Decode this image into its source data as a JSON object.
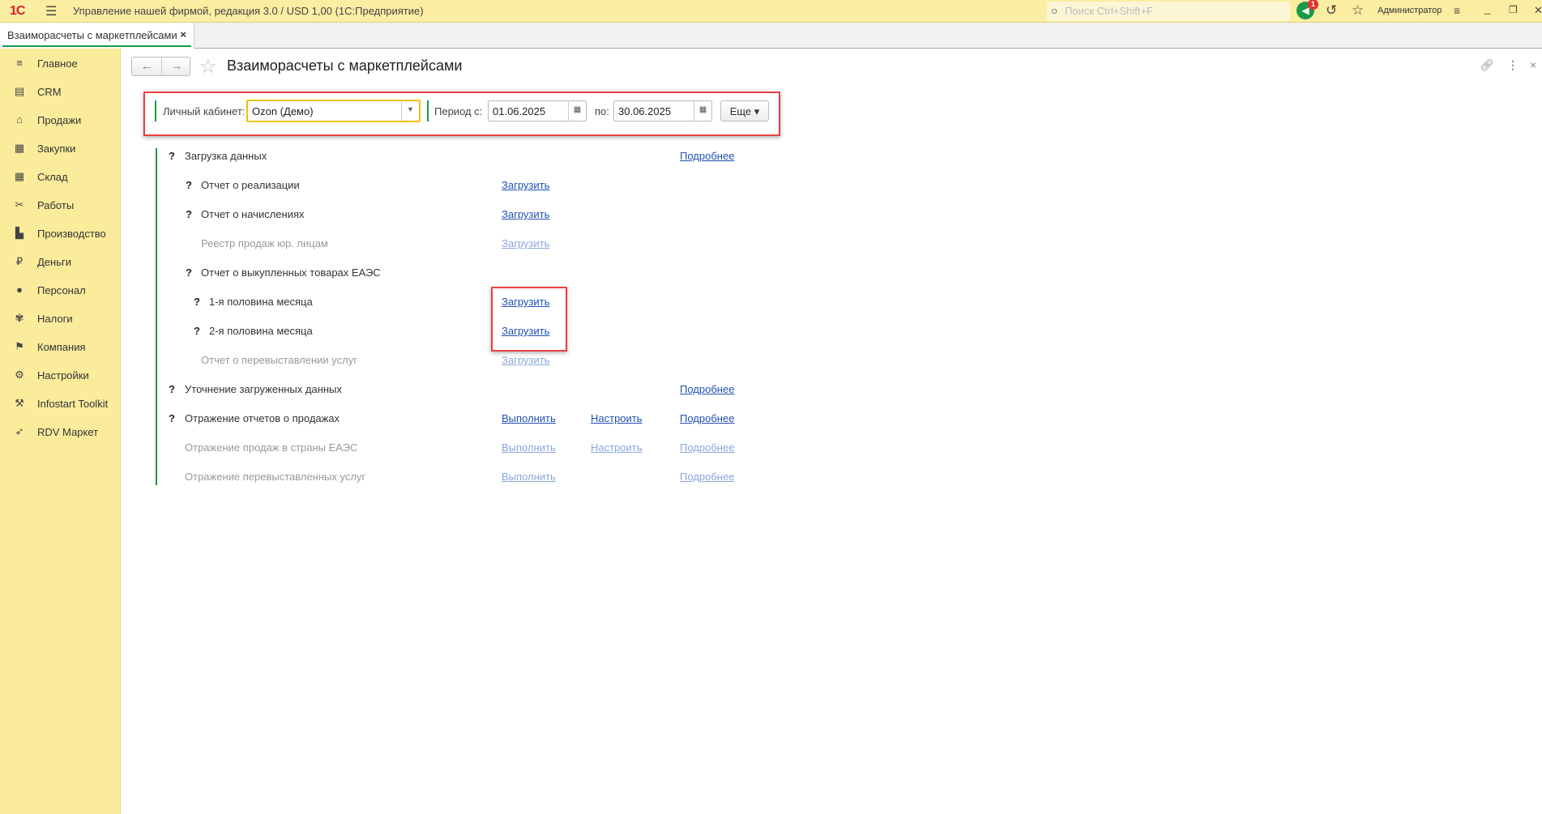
{
  "titlebar": {
    "logo": "1С",
    "title": "Управление нашей фирмой, редакция 3.0 / USD 1,00  (1С:Предприятие)",
    "search_placeholder": "Поиск Ctrl+Shift+F",
    "notifications_count": "1",
    "user": "Администратор"
  },
  "tab": {
    "label": "Взаиморасчеты с маркетплейсами",
    "close": "×"
  },
  "sidebar": {
    "items": [
      {
        "label": "Главное",
        "icon": "≡"
      },
      {
        "label": "CRM",
        "icon": "▤"
      },
      {
        "label": "Продажи",
        "icon": "⌂"
      },
      {
        "label": "Закупки",
        "icon": "▦"
      },
      {
        "label": "Склад",
        "icon": "▦"
      },
      {
        "label": "Работы",
        "icon": "✂"
      },
      {
        "label": "Производство",
        "icon": "▙"
      },
      {
        "label": "Деньги",
        "icon": "₽"
      },
      {
        "label": "Персонал",
        "icon": "●"
      },
      {
        "label": "Налоги",
        "icon": "✾"
      },
      {
        "label": "Компания",
        "icon": "⚑"
      },
      {
        "label": "Настройки",
        "icon": "⚙"
      },
      {
        "label": "Infostart Toolkit",
        "icon": "⚒"
      },
      {
        "label": "RDV Маркет",
        "icon": "➶"
      }
    ]
  },
  "page": {
    "title": "Взаиморасчеты с маркетплейсами"
  },
  "filters": {
    "account_label": "Личный кабинет:",
    "account_value": "Ozon (Демо)",
    "period_from_label": "Период с:",
    "period_from": "01.06.2025",
    "period_to_label": "по:",
    "period_to": "30.06.2025",
    "more_label": "Еще ▾"
  },
  "rows": [
    {
      "q": "?",
      "text": "Загрузка данных",
      "more": "Подробнее"
    },
    {
      "q": "?",
      "text": "Отчет о реализации",
      "load": "Загрузить"
    },
    {
      "q": "?",
      "text": "Отчет о начислениях",
      "load": "Загрузить"
    },
    {
      "text": "Реестр продаж юр. лицам",
      "load": "Загрузить"
    },
    {
      "q": "?",
      "text": "Отчет о выкупленных товарах ЕАЭС"
    },
    {
      "q": "?",
      "text": "1-я половина месяца",
      "load": "Загрузить"
    },
    {
      "q": "?",
      "text": "2-я половина месяца",
      "load": "Загрузить"
    },
    {
      "text": "Отчет о перевыставлении услуг",
      "load": "Загрузить"
    },
    {
      "q": "?",
      "text": "Уточнение загруженных данных",
      "more": "Подробнее"
    },
    {
      "q": "?",
      "text": "Отражение отчетов о продажах",
      "run": "Выполнить",
      "setup": "Настроить",
      "more": "Подробнее"
    },
    {
      "text": "Отражение продаж в страны ЕАЭС",
      "run": "Выполнить",
      "setup": "Настроить",
      "more": "Подробнее"
    },
    {
      "text": "Отражение перевыставленных услуг",
      "run": "Выполнить",
      "more": "Подробнее"
    }
  ]
}
